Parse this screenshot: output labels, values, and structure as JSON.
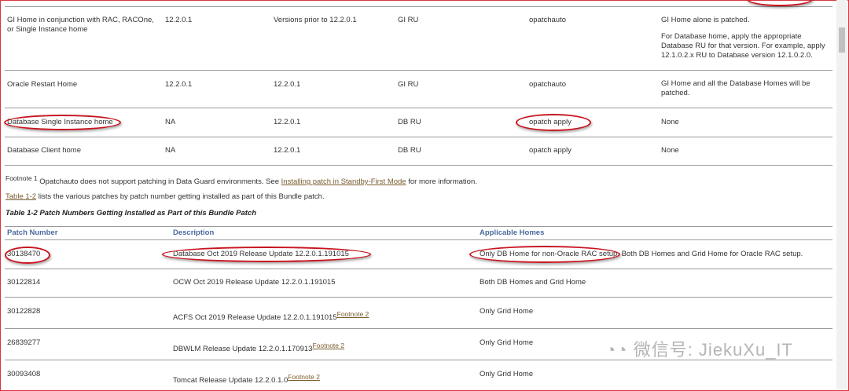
{
  "table1": {
    "rows": [
      {
        "home": "GI Home in conjunction with RAC, RACOne, or Single Instance home",
        "version": "12.2.0.1",
        "db_version": "Versions prior to 12.2.0.1",
        "patch_type": "GI RU",
        "tool": "opatchauto",
        "notes": [
          "GI Home alone is patched.",
          "For Database home, apply the appropriate Database RU for that version. For example, apply 12.1.0.2.x RU to Database version 12.1.0.2.0."
        ]
      },
      {
        "home": "Oracle Restart Home",
        "version": "12.2.0.1",
        "db_version": "12.2.0.1",
        "patch_type": "GI RU",
        "tool": "opatchauto",
        "notes": [
          "GI Home and all the Database Homes will be patched."
        ]
      },
      {
        "home": "Database Single Instance home",
        "version": "NA",
        "db_version": "12.2.0.1",
        "patch_type": "DB RU",
        "tool": "opatch apply",
        "notes": [
          "None"
        ]
      },
      {
        "home": "Database Client home",
        "version": "NA",
        "db_version": "12.2.0.1",
        "patch_type": "DB RU",
        "tool": "opatch apply",
        "notes": [
          "None"
        ]
      }
    ]
  },
  "footnote": {
    "label": "Footnote 1",
    "text": "Opatchauto does not support patching in Data Guard environments. See ",
    "link": "Installing patch in Standby-First Mode",
    "suffix": " for more information."
  },
  "intro": {
    "link": "Table 1-2",
    "text": " lists the various patches by patch number getting installed as part of this Bundle patch."
  },
  "table2": {
    "caption": "Table 1-2 Patch Numbers Getting Installed as Part of this Bundle Patch",
    "headers": [
      "Patch Number",
      "Description",
      "Applicable Homes"
    ],
    "rows": [
      {
        "num": "30138470",
        "desc": "Database Oct 2019 Release Update 12.2.0.1.191015",
        "fn": "",
        "homes": "Only DB Home for non-Oracle RAC setup. Both DB Homes and Grid Home for Oracle RAC setup."
      },
      {
        "num": "30122814",
        "desc": "OCW Oct 2019 Release Update 12.2.0.1.191015",
        "fn": "",
        "homes": "Both DB Homes and Grid Home"
      },
      {
        "num": "30122828",
        "desc": "ACFS Oct 2019 Release Update 12.2.0.1.191015",
        "fn": "Footnote 2",
        "homes": "Only Grid Home"
      },
      {
        "num": "26839277",
        "desc": "DBWLM Release Update 12.2.0.1.170913",
        "fn": "Footnote 2",
        "homes": "Only Grid Home"
      },
      {
        "num": "30093408",
        "desc": "Tomcat Release Update 12.2.0.1.0",
        "fn": "Footnote 2",
        "homes": "Only Grid Home"
      }
    ]
  },
  "watermark": "微信号: JiekuXu_IT"
}
